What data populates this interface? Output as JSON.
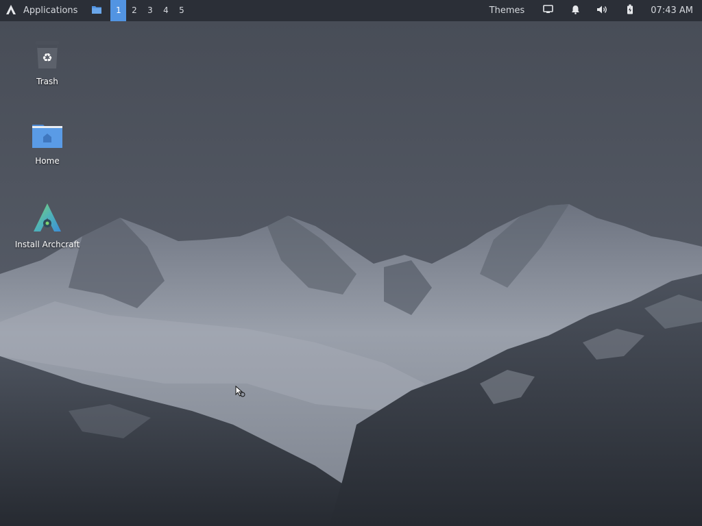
{
  "panel": {
    "applications_label": "Applications",
    "workspaces": [
      "1",
      "2",
      "3",
      "4",
      "5"
    ],
    "active_workspace": "1",
    "themes_label": "Themes",
    "clock": "07:43 AM",
    "accent_color": "#5294e2",
    "background_color": "#2b2f37",
    "icons": [
      "archcraft-logo-icon",
      "file-manager-icon",
      "display-icon",
      "bell-icon",
      "volume-icon",
      "battery-icon"
    ]
  },
  "desktop": {
    "icons": [
      {
        "label": "Trash",
        "icon": "trash-icon"
      },
      {
        "label": "Home",
        "icon": "home-folder-icon"
      },
      {
        "label": "Install Archcraft",
        "icon": "archcraft-installer-icon"
      }
    ],
    "wallpaper": "snowy-mountains"
  }
}
